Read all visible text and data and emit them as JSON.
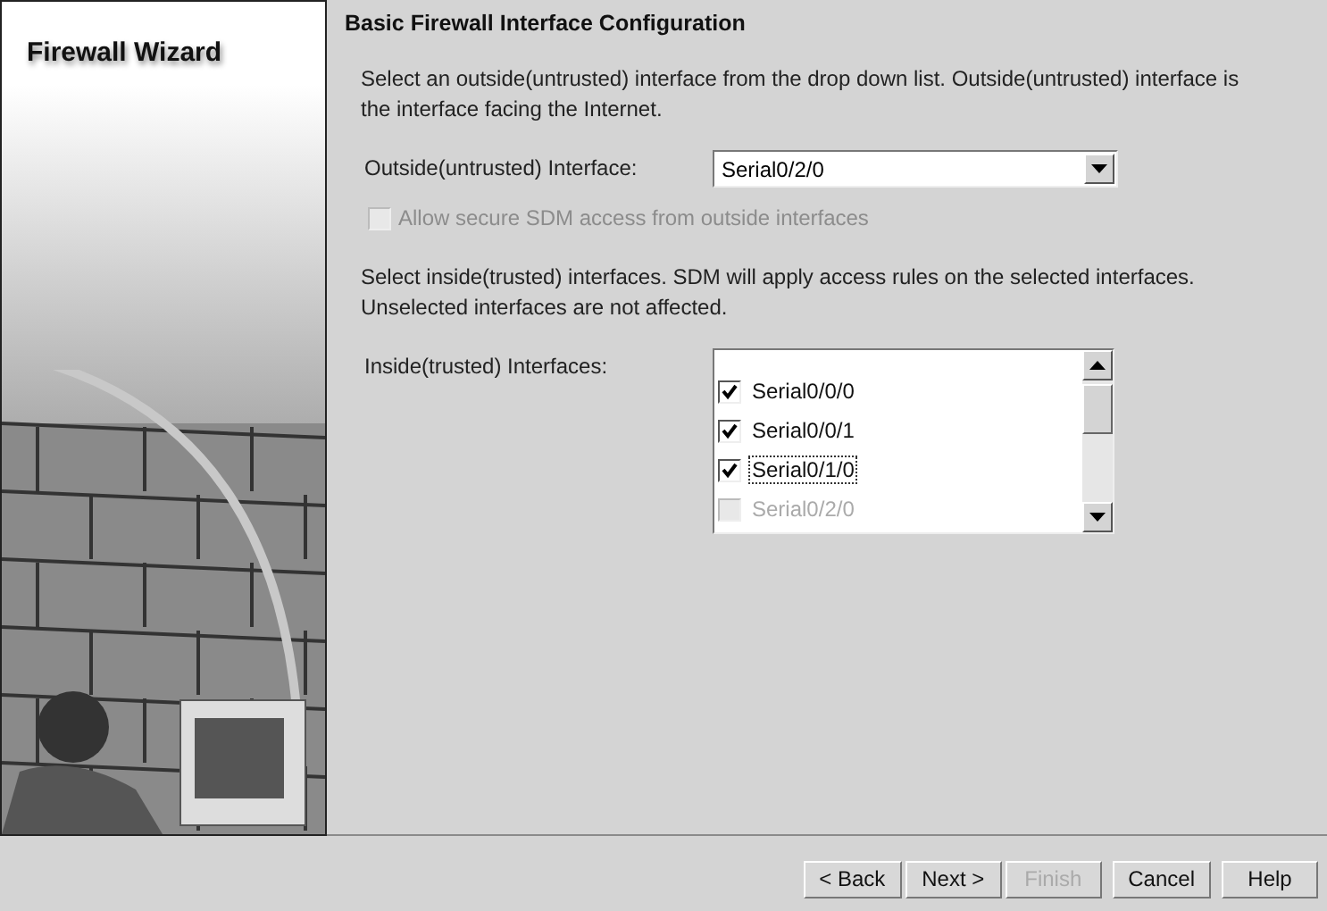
{
  "sidebar": {
    "title": "Firewall Wizard"
  },
  "page": {
    "heading": "Basic Firewall Interface Configuration",
    "outside_intro": "Select an outside(untrusted) interface from the drop down list. Outside(untrusted) interface is the interface facing the Internet.",
    "outside_label": "Outside(untrusted) Interface:",
    "outside_value": "Serial0/2/0",
    "allow_sdm": {
      "label": "Allow secure SDM access from outside interfaces",
      "checked": false,
      "disabled": true
    },
    "inside_intro": "Select inside(trusted) interfaces. SDM will apply access rules on the selected interfaces. Unselected interfaces are not affected.",
    "inside_label": "Inside(trusted) Interfaces:",
    "inside_interfaces": [
      {
        "label": "Serial0/0/0",
        "checked": true,
        "disabled": false,
        "focused": false
      },
      {
        "label": "Serial0/0/1",
        "checked": true,
        "disabled": false,
        "focused": false
      },
      {
        "label": "Serial0/1/0",
        "checked": true,
        "disabled": false,
        "focused": true
      },
      {
        "label": "Serial0/2/0",
        "checked": false,
        "disabled": true,
        "focused": false
      }
    ]
  },
  "buttons": [
    {
      "label": "< Back",
      "disabled": false
    },
    {
      "label": "Next >",
      "disabled": false
    },
    {
      "label": "Finish",
      "disabled": true
    },
    {
      "label": "Cancel",
      "disabled": false
    },
    {
      "label": "Help",
      "disabled": false
    }
  ]
}
